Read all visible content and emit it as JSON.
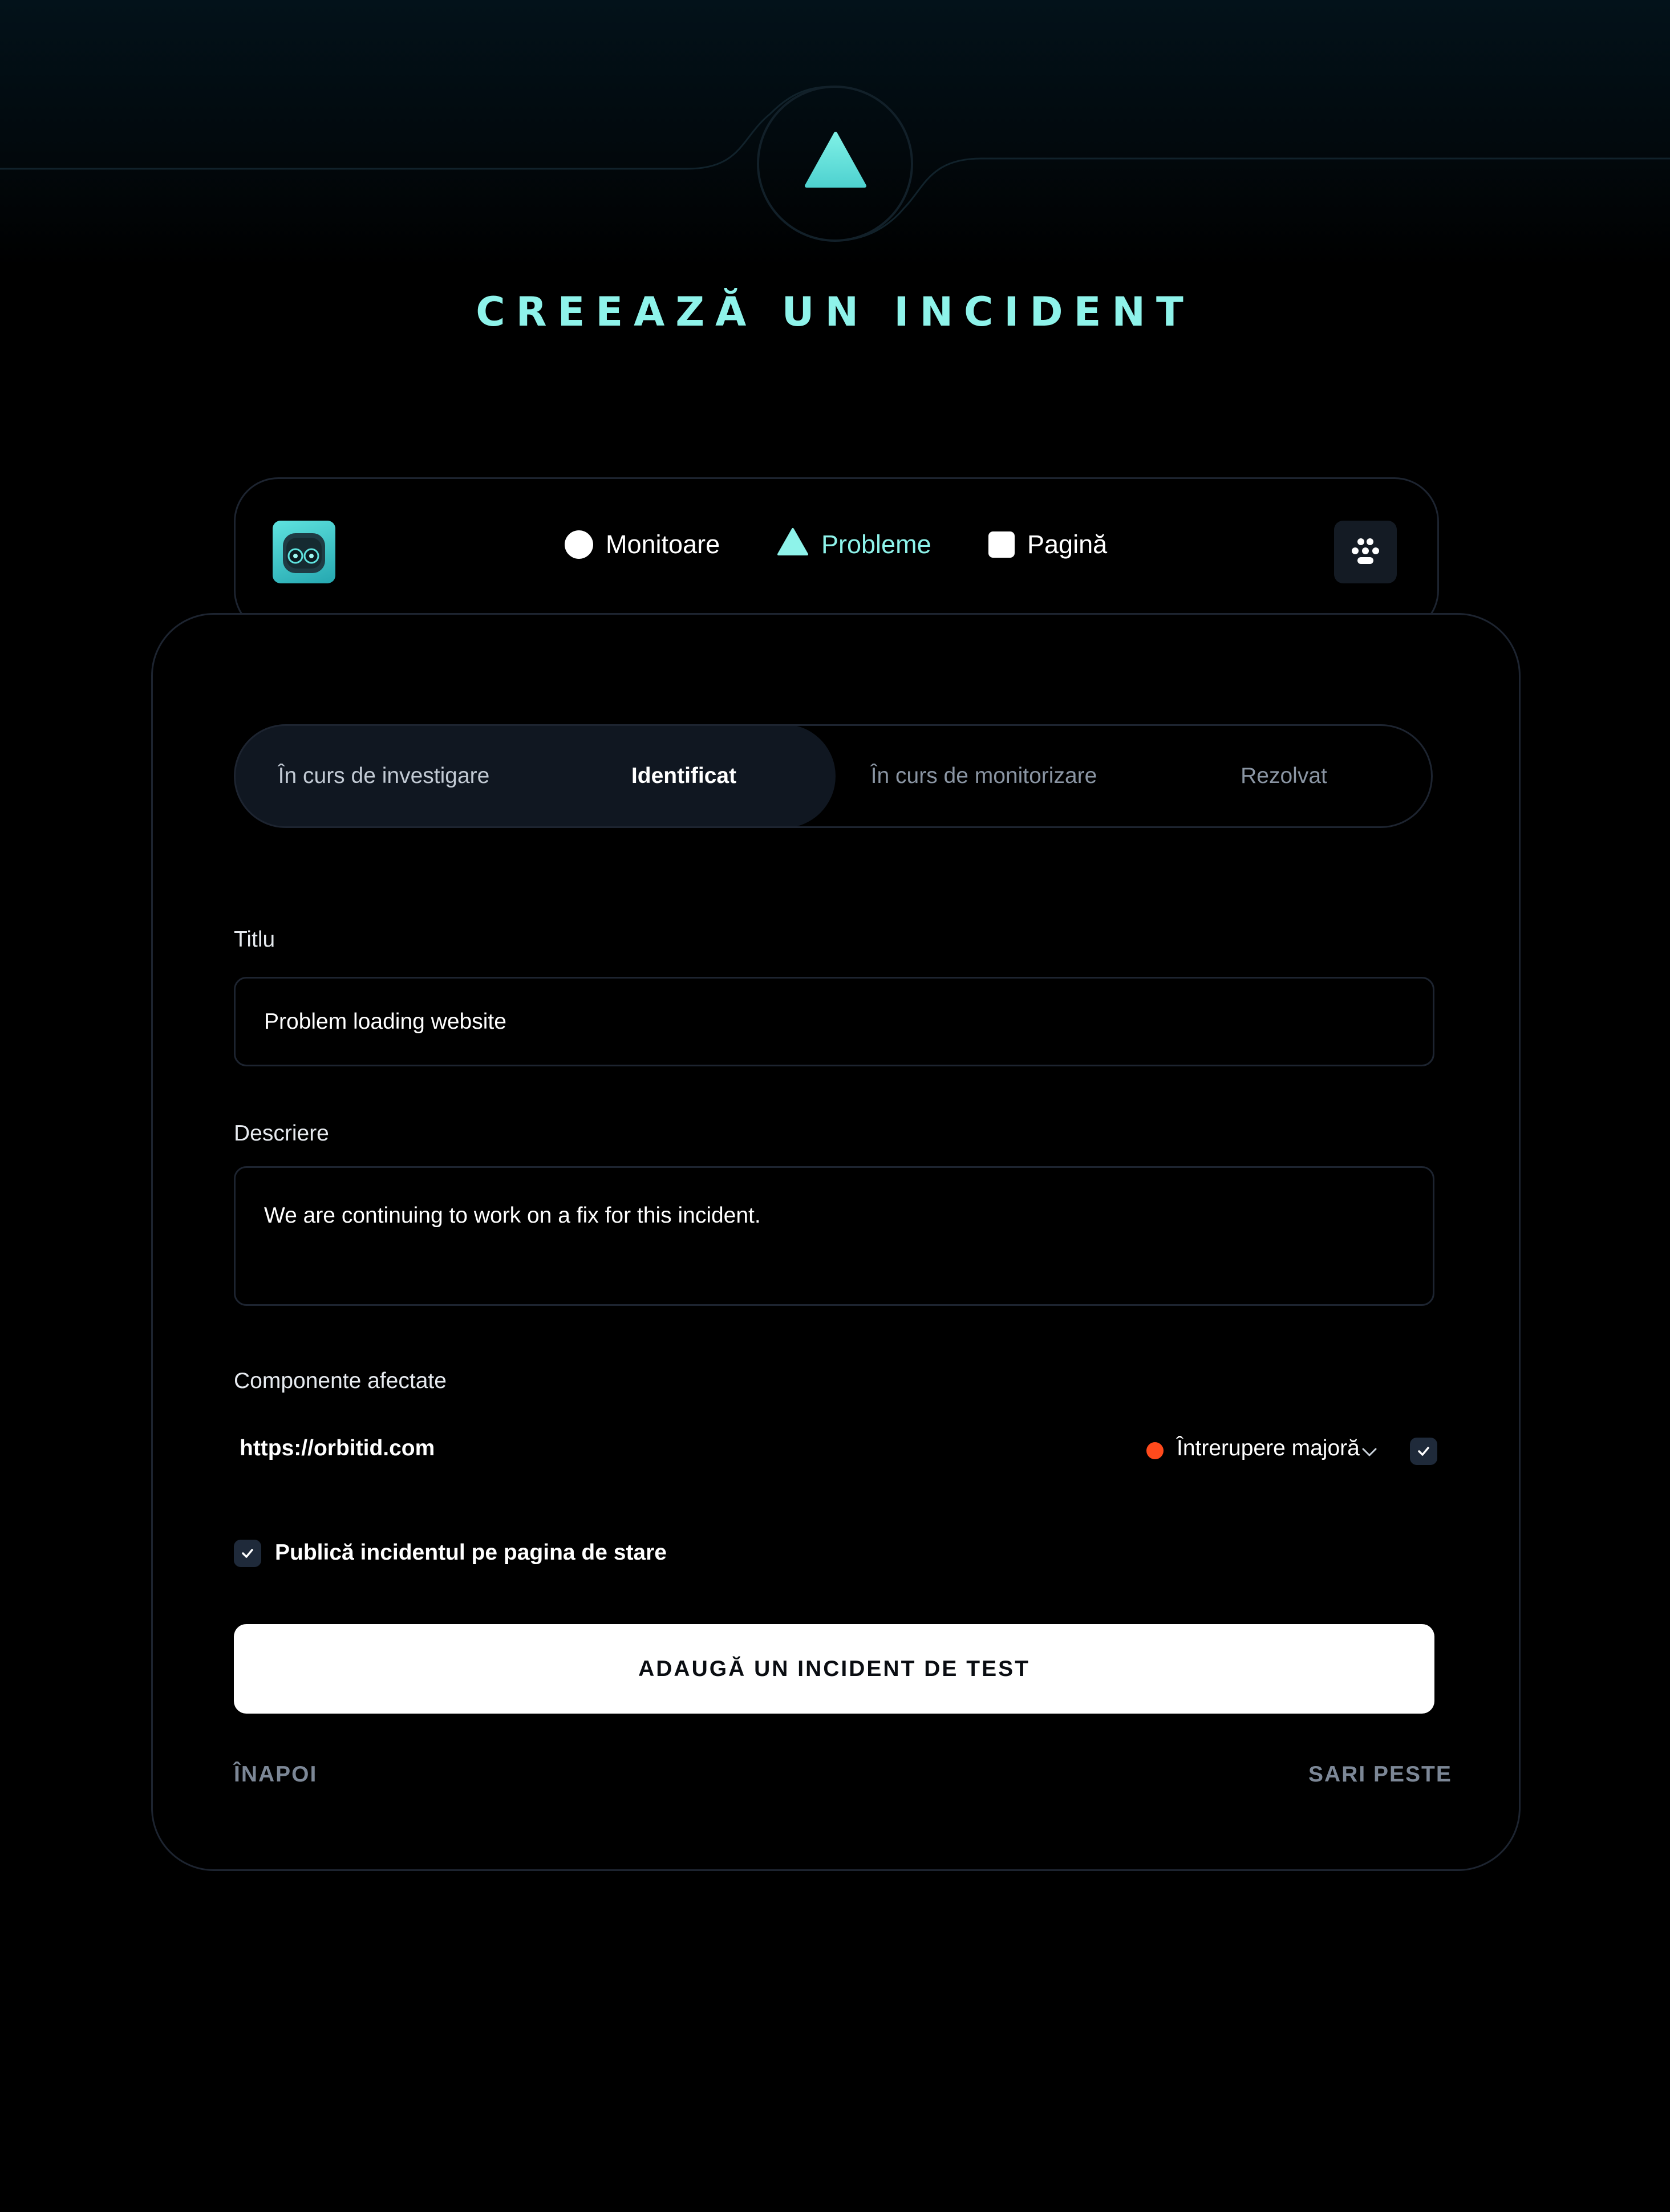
{
  "page": {
    "title": "CREEAZĂ UN INCIDENT"
  },
  "nav": {
    "items": [
      {
        "label": "Monitoare",
        "icon": "circle-icon"
      },
      {
        "label": "Probleme",
        "icon": "triangle-icon",
        "active": true
      },
      {
        "label": "Pagină",
        "icon": "square-icon"
      }
    ]
  },
  "status_tabs": {
    "items": [
      "În curs de investigare",
      "Identificat",
      "În curs de monitorizare",
      "Rezolvat"
    ],
    "selected": "Identificat"
  },
  "form": {
    "title_label": "Titlu",
    "title_value": "Problem loading website",
    "description_label": "Descriere",
    "description_value": "We are continuing to work on a fix for this incident.",
    "components_label": "Componente afectate",
    "component": {
      "url": "https://orbitid.com",
      "status": "Întrerupere majoră",
      "checked": true
    },
    "publish_label": "Publică incidentul pe pagina de stare",
    "publish_checked": true,
    "submit_label": "ADAUGĂ UN INCIDENT DE TEST",
    "back_label": "ÎNAPOI",
    "skip_label": "SARI PESTE"
  },
  "colors": {
    "accent": "#8ef3ea",
    "background": "#000000",
    "border": "#1d2430",
    "status_major_outage": "#ff4a1c",
    "muted_text": "#7c8796"
  }
}
